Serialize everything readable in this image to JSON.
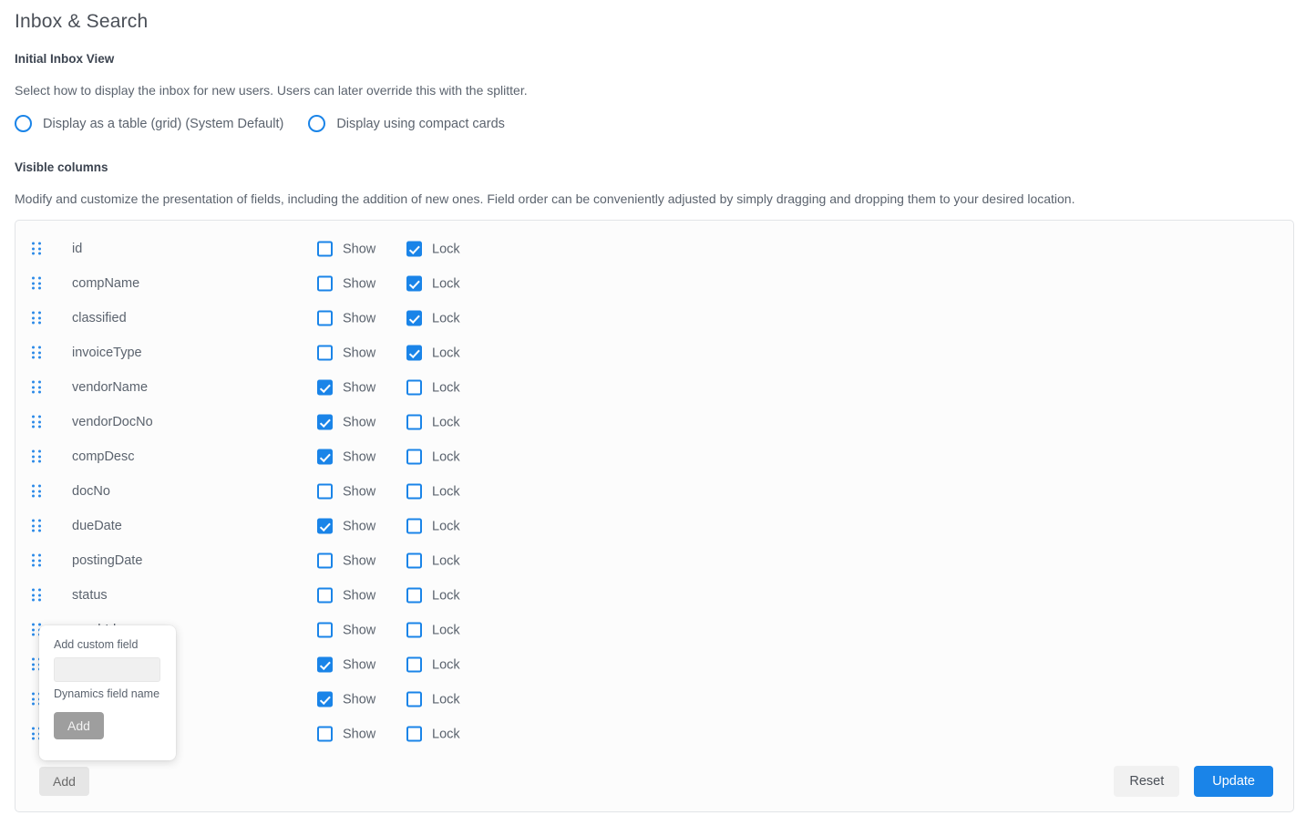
{
  "page": {
    "title": "Inbox & Search"
  },
  "initial_inbox_view": {
    "label": "Initial Inbox View",
    "help": "Select how to display the inbox for new users. Users can later override this with the splitter.",
    "options": [
      {
        "label": "Display as a table (grid) (System Default)",
        "selected": false
      },
      {
        "label": "Display using compact cards",
        "selected": false
      }
    ]
  },
  "visible_columns": {
    "label": "Visible columns",
    "help": "Modify and customize the presentation of fields, including the addition of new ones. Field order can be conveniently adjusted by simply dragging and dropping them to your desired location.",
    "show_label": "Show",
    "lock_label": "Lock",
    "rows": [
      {
        "name": "id",
        "show": false,
        "lock": true
      },
      {
        "name": "compName",
        "show": false,
        "lock": true
      },
      {
        "name": "classified",
        "show": false,
        "lock": true
      },
      {
        "name": "invoiceType",
        "show": false,
        "lock": true
      },
      {
        "name": "vendorName",
        "show": true,
        "lock": false
      },
      {
        "name": "vendorDocNo",
        "show": true,
        "lock": false
      },
      {
        "name": "compDesc",
        "show": true,
        "lock": false
      },
      {
        "name": "docNo",
        "show": false,
        "lock": false
      },
      {
        "name": "dueDate",
        "show": true,
        "lock": false
      },
      {
        "name": "postingDate",
        "show": false,
        "lock": false
      },
      {
        "name": "status",
        "show": false,
        "lock": false
      },
      {
        "name": "purchId",
        "show": false,
        "lock": false
      },
      {
        "name": "",
        "show": true,
        "lock": false
      },
      {
        "name": "",
        "show": true,
        "lock": false
      },
      {
        "name": "",
        "show": false,
        "lock": false
      }
    ],
    "add_label": "Add",
    "reset_label": "Reset",
    "update_label": "Update"
  },
  "add_custom_field_popup": {
    "title": "Add custom field",
    "input_value": "",
    "input_placeholder": "",
    "helper": "Dynamics field name",
    "add_label": "Add"
  }
}
